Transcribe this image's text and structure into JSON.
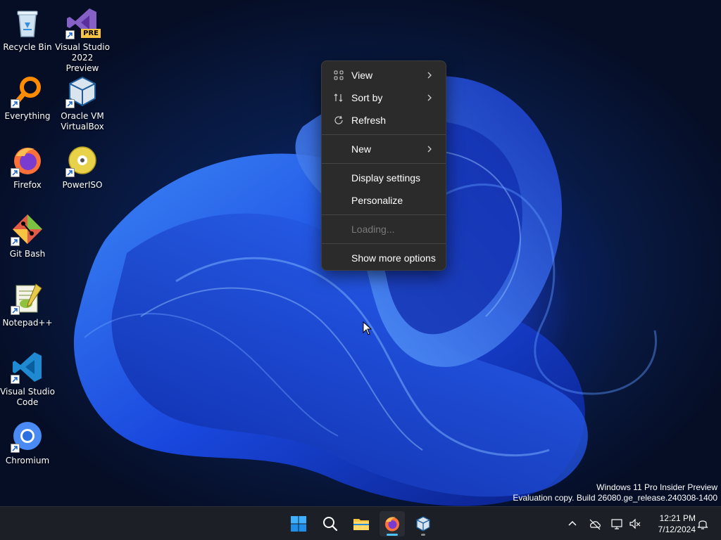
{
  "desktop": {
    "icons": [
      {
        "label": "Recycle Bin",
        "icon": "recycle-bin-icon"
      },
      {
        "label": "Visual Studio 2022 Preview",
        "icon": "visual-studio-icon",
        "badge": "PRE"
      },
      {
        "label": "Everything",
        "icon": "magnifier-orange-icon"
      },
      {
        "label": "Oracle VM VirtualBox",
        "icon": "virtualbox-icon"
      },
      {
        "label": "Firefox",
        "icon": "firefox-icon"
      },
      {
        "label": "PowerISO",
        "icon": "disc-icon"
      },
      {
        "label": "Git Bash",
        "icon": "git-icon"
      },
      {
        "label": "Notepad++",
        "icon": "notepad-icon"
      },
      {
        "label": "Visual Studio Code",
        "icon": "vscode-icon"
      },
      {
        "label": "Chromium",
        "icon": "chromium-icon"
      }
    ]
  },
  "context_menu": {
    "items": [
      {
        "label": "View",
        "icon": "grid-icon",
        "submenu": true
      },
      {
        "label": "Sort by",
        "icon": "sort-icon",
        "submenu": true
      },
      {
        "label": "Refresh",
        "icon": "refresh-icon",
        "submenu": false
      },
      {
        "label": "New",
        "submenu": true
      },
      {
        "label": "Display settings"
      },
      {
        "label": "Personalize"
      },
      {
        "label": "Loading...",
        "disabled": true
      },
      {
        "label": "Show more options"
      }
    ]
  },
  "watermark": {
    "line1": "Windows 11 Pro Insider Preview",
    "line2": "Evaluation copy. Build 26080.ge_release.240308-1400"
  },
  "taskbar": {
    "apps": [
      "start-icon",
      "search-icon",
      "file-explorer-icon",
      "firefox-icon",
      "virtualbox-icon"
    ],
    "clock": {
      "time": "12:21 PM",
      "date": "7/12/2024"
    }
  },
  "colors": {
    "menu_bg": "#2b2b2b",
    "taskbar_bg": "#1c1f26",
    "accent": "#4cc2ff"
  }
}
